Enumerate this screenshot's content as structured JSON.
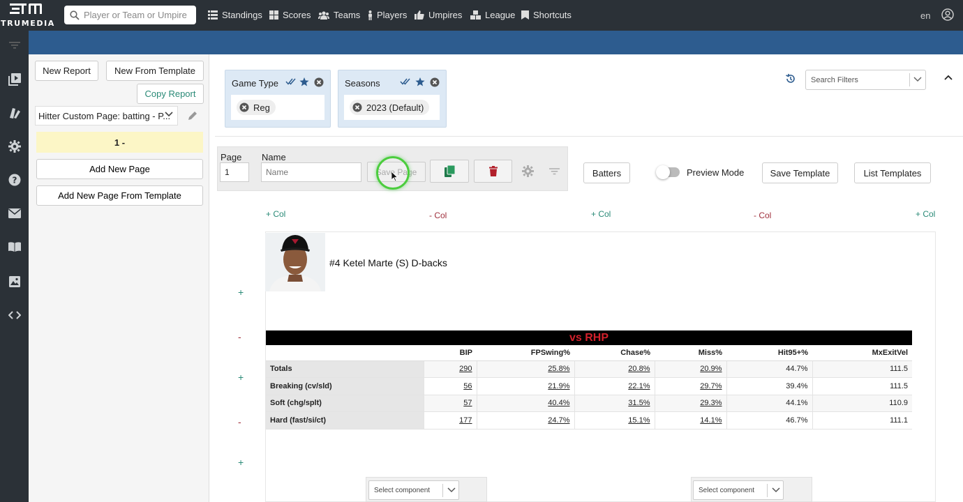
{
  "app": {
    "brand": "TRUMEDIA"
  },
  "search": {
    "placeholder": "Player or Team or Umpire"
  },
  "nav": {
    "standings": "Standings",
    "scores": "Scores",
    "teams": "Teams",
    "players": "Players",
    "umpires": "Umpires",
    "league": "League",
    "shortcuts": "Shortcuts",
    "lang": "en"
  },
  "panel": {
    "new_report": "New Report",
    "new_from_template": "New From Template",
    "copy_report": "Copy Report",
    "report_select": "Hitter Custom Page: batting - P...",
    "page_entry": "1 -",
    "add_new_page": "Add New Page",
    "add_new_page_template": "Add New Page From Template"
  },
  "filters": {
    "game_type": {
      "title": "Game Type",
      "value": "Reg"
    },
    "seasons": {
      "title": "Seasons",
      "value": "2023 (Default)"
    },
    "search_placeholder": "Search Filters"
  },
  "pagebar": {
    "page_label": "Page",
    "page_value": "1",
    "name_label": "Name",
    "name_placeholder": "Name",
    "save_page": "Save Page"
  },
  "toolbar": {
    "batters": "Batters",
    "preview_mode": "Preview Mode",
    "save_template": "Save Template",
    "list_templates": "List Templates"
  },
  "layout": {
    "add_col": "+ Col",
    "remove_col": "- Col",
    "add_row": "+",
    "remove_row": "-"
  },
  "player": {
    "name": "#4 Ketel Marte (S) D-backs"
  },
  "table": {
    "title": "vs RHP",
    "columns": [
      "",
      "BIP",
      "FPSwing%",
      "Chase%",
      "Miss%",
      "Hit95+%",
      "MxExitVel"
    ],
    "rows": [
      [
        "Totals",
        "290",
        "25.8%",
        "20.8%",
        "20.9%",
        "44.7%",
        "111.5"
      ],
      [
        "Breaking (cv/sld)",
        "56",
        "21.9%",
        "22.1%",
        "29.7%",
        "39.4%",
        "111.5"
      ],
      [
        "Soft (chg/splt)",
        "57",
        "40.4%",
        "31.5%",
        "29.3%",
        "44.1%",
        "110.9"
      ],
      [
        "Hard (fast/si/ct)",
        "177",
        "24.7%",
        "15.1%",
        "14.1%",
        "46.7%",
        "111.1"
      ]
    ]
  },
  "components": {
    "select_placeholder": "Select component"
  },
  "colors": {
    "accent_blue": "#2d5c8f",
    "nav_dark": "#2b3137",
    "teal": "#2a8a77",
    "red": "#d2202b"
  }
}
